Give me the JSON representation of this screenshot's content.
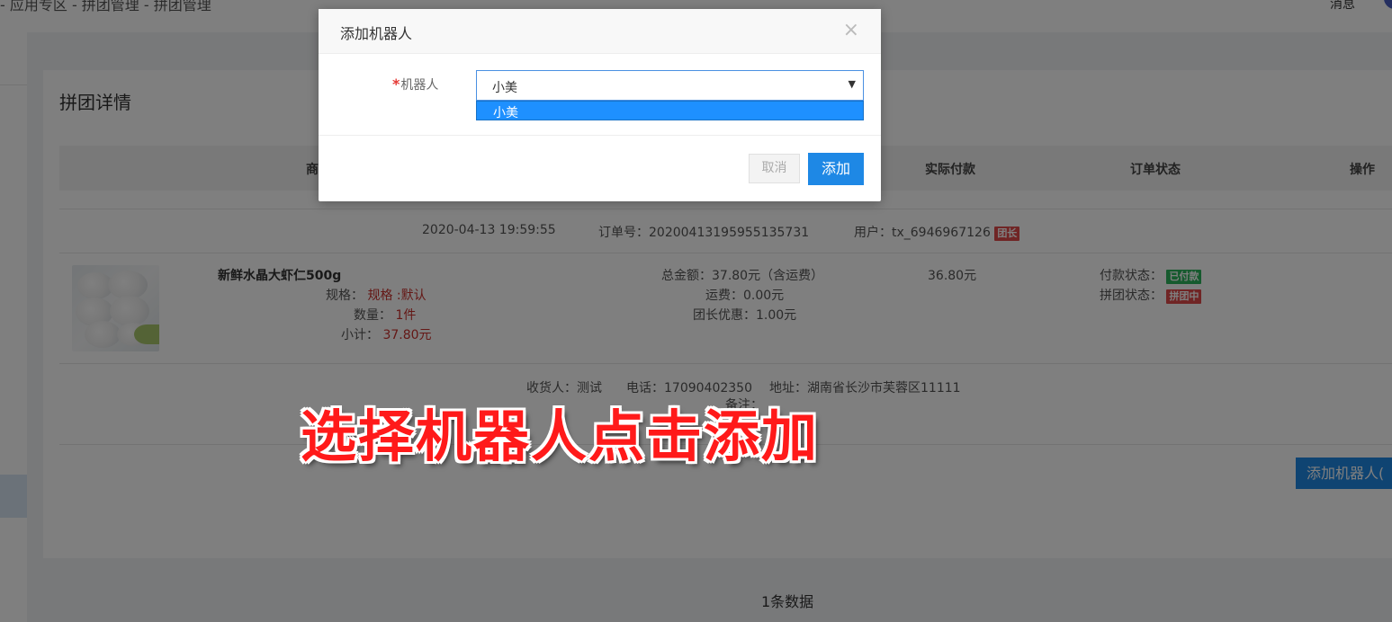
{
  "header": {
    "breadcrumb": "- 应用专区 - 拼团管理 - 拼团管理",
    "messages": "消息"
  },
  "panel": {
    "title": "拼团详情",
    "columns": [
      "商",
      "实际付款",
      "订单状态",
      "操作"
    ]
  },
  "order": {
    "datetime": "2020-04-13 19:59:55",
    "order_no": "订单号：20200413195955135731",
    "user": "用户：tx_6946967126",
    "leader_badge": "团长",
    "product": {
      "name": "新鲜水晶大虾仁500g",
      "spec_label": "规格：",
      "spec_value": "规格 :默认",
      "qty_label": "数量：",
      "qty_value": "1件",
      "subtotal_label": "小计：",
      "subtotal_value": "37.80元"
    },
    "totals": {
      "total": "总金额：37.80元（含运费）",
      "shipping": "运费：0.00元",
      "leader_discount": "团长优惠：1.00元"
    },
    "actual_paid": "36.80元",
    "status": {
      "pay_label": "付款状态：",
      "pay_badge": "已付款",
      "group_label": "拼团状态：",
      "group_badge": "拼团中"
    },
    "recipient": "收货人：测试",
    "phone": "电话：17090402350",
    "address": "地址：湖南省长沙市芙蓉区11111",
    "remark": "备注："
  },
  "add_robot_button": "添加机器人(",
  "total_count": "1条数据",
  "caption": "选择机器人点击添加",
  "modal": {
    "title": "添加机器人",
    "close": "×",
    "field_required": "*",
    "field_label": "机器人",
    "select_value": "小美",
    "select_arrow": "▼",
    "options": [
      "小美"
    ],
    "cancel": "取消",
    "confirm": "添加"
  },
  "colors": {
    "primary": "#1e88e5",
    "danger_badge": "#e04b4b",
    "success_badge": "#2db55d",
    "option_highlight": "#1e90ff",
    "caption": "#ff1a1a"
  }
}
